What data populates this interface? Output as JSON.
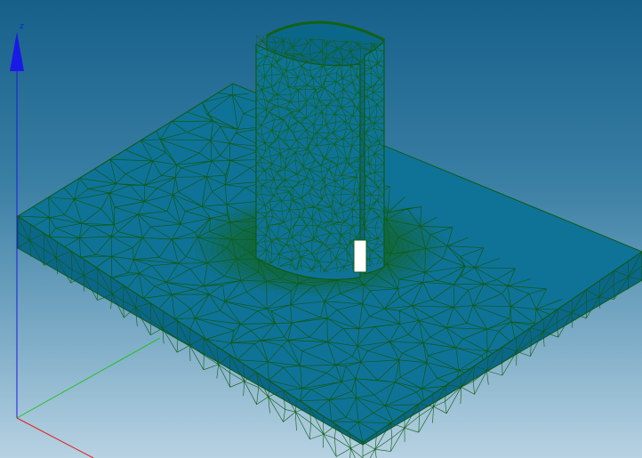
{
  "viewport": {
    "background_top": "#16608a",
    "background_bottom": "#b7d2e2"
  },
  "mesh": {
    "face_color": "#0f7398",
    "face_shade": "#0b6789",
    "edge_color": "#0d5a12",
    "dense_edge_color": "#106214"
  },
  "axes": {
    "z_label": "z",
    "z_color": "#1a1ae6",
    "y_color": "#22c022",
    "x_color": "#e02020"
  }
}
